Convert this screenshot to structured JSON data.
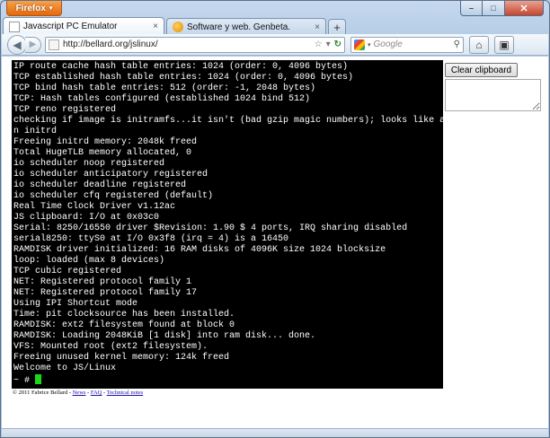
{
  "browser": {
    "menu_label": "Firefox",
    "menu_arrow": "▾",
    "controls": {
      "minimize": "–",
      "maximize": "□",
      "close": "✕"
    }
  },
  "tabs": [
    {
      "label": "Javascript PC Emulator",
      "close": "×",
      "active": true
    },
    {
      "label": "Software y web. Genbeta.",
      "close": "×",
      "active": false
    }
  ],
  "new_tab_label": "+",
  "nav": {
    "back": "◀",
    "forward": "▶",
    "url": "http://bellard.org/jslinux/",
    "star": "☆",
    "dropdown": "▾",
    "reload": "↻",
    "search_placeholder": "Google",
    "search_engine_arrow": "▾",
    "search_icon": "⚲",
    "home_icon": "⌂",
    "addon_icon": "▣"
  },
  "page": {
    "clear_clipboard_label": "Clear clipboard",
    "clipboard_value": "",
    "terminal_lines": [
      "IP route cache hash table entries: 1024 (order: 0, 4096 bytes)",
      "TCP established hash table entries: 1024 (order: 0, 4096 bytes)",
      "TCP bind hash table entries: 512 (order: -1, 2048 bytes)",
      "TCP: Hash tables configured (established 1024 bind 512)",
      "TCP reno registered",
      "checking if image is initramfs...it isn't (bad gzip magic numbers); looks like a",
      "n initrd",
      "Freeing initrd memory: 2048k freed",
      "Total HugeTLB memory allocated, 0",
      "io scheduler noop registered",
      "io scheduler anticipatory registered",
      "io scheduler deadline registered",
      "io scheduler cfq registered (default)",
      "Real Time Clock Driver v1.12ac",
      "JS clipboard: I/O at 0x03c0",
      "Serial: 8250/16550 driver $Revision: 1.90 $ 4 ports, IRQ sharing disabled",
      "serial8250: ttyS0 at I/O 0x3f8 (irq = 4) is a 16450",
      "RAMDISK driver initialized: 16 RAM disks of 4096K size 1024 blocksize",
      "loop: loaded (max 8 devices)",
      "TCP cubic registered",
      "NET: Registered protocol family 1",
      "NET: Registered protocol family 17",
      "Using IPI Shortcut mode",
      "Time: pit clocksource has been installed.",
      "RAMDISK: ext2 filesystem found at block 0",
      "RAMDISK: Loading 2048KiB [1 disk] into ram disk... done.",
      "VFS: Mounted root (ext2 filesystem).",
      "Freeing unused kernel memory: 124k freed",
      "Welcome to JS/Linux"
    ],
    "prompt": "~ # ",
    "footer": {
      "copyright": "© 2011 Fabrice Bellard - ",
      "links": [
        "News",
        "FAQ",
        "Technical notes"
      ],
      "separator": " - "
    }
  },
  "colors": {
    "terminal_bg": "#000000",
    "terminal_fg": "#ffffff",
    "cursor": "#18d818",
    "firefox_orange": "#e2690f"
  }
}
